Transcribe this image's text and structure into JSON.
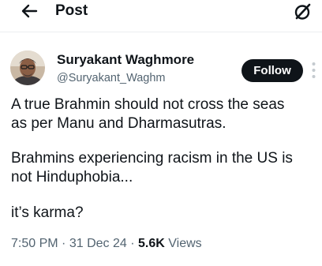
{
  "header": {
    "title": "Post",
    "back_icon": "back-arrow-icon",
    "right_icon": "grok-icon"
  },
  "author": {
    "name": "Suryakant Waghmore",
    "handle": "@Suryakant_Waghm",
    "avatar_icon": "avatar-photo"
  },
  "follow": {
    "label": "Follow"
  },
  "more_icon": "more-options-icon",
  "tweet": {
    "paragraphs": [
      "A true Brahmin should not cross the seas\nas per Manu and Dharmasutras.",
      "Brahmins experiencing racism in the US is\nnot Hinduphobia...",
      "it’s karma?"
    ]
  },
  "meta": {
    "time": "7:50 PM",
    "separator": "·",
    "date": "31 Dec 24",
    "views_count": "5.6K",
    "views_label": "Views"
  },
  "colors": {
    "text": "#0f1419",
    "secondary": "#536471",
    "button_bg": "#0f1419",
    "button_text": "#ffffff"
  }
}
